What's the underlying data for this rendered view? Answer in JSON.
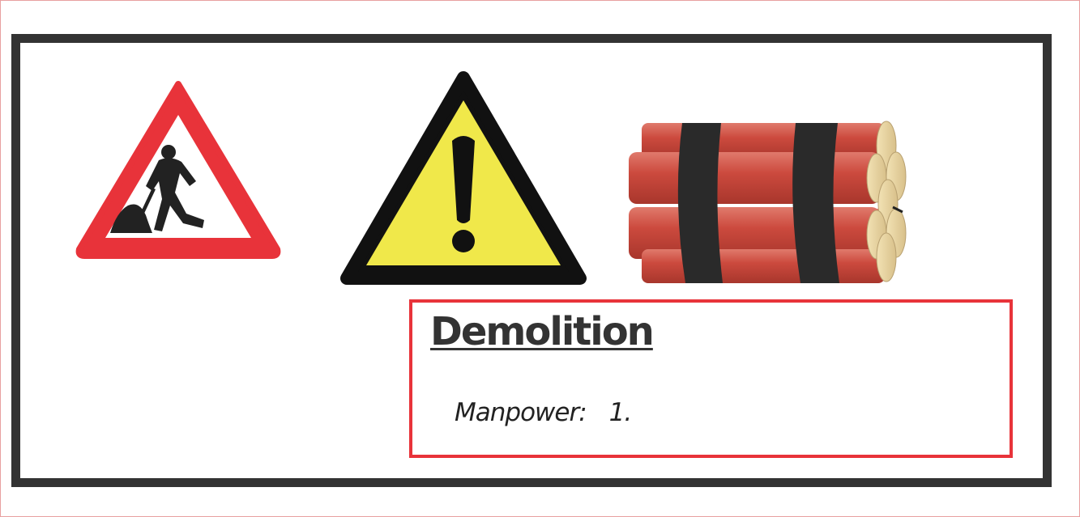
{
  "signs": {
    "roadworks": {
      "icon": "roadworks-sign-icon"
    },
    "warning": {
      "icon": "exclamation-warning-icon"
    },
    "dynamite": {
      "icon": "dynamite-bundle-icon"
    }
  },
  "info": {
    "title": "Demolition",
    "manpower_label": "Manpower:",
    "manpower_value": "1."
  },
  "colors": {
    "frame": "#333333",
    "box_border": "#e8333a",
    "sign_red": "#e8333a",
    "warning_yellow": "#f0e84a",
    "dynamite_red": "#c8463c",
    "dynamite_end": "#e8d4a0"
  }
}
